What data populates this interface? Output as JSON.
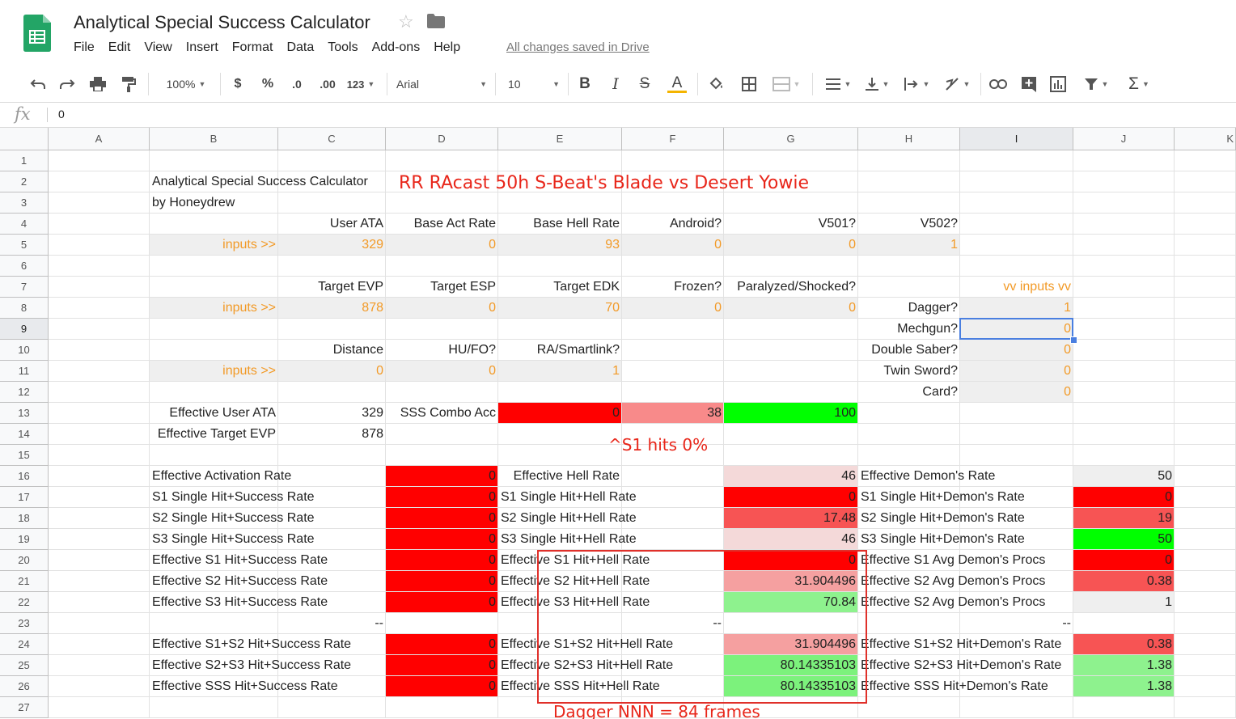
{
  "doc": {
    "title": "Analytical Special Success Calculator",
    "save_status": "All changes saved in Drive",
    "menu": [
      "File",
      "Edit",
      "View",
      "Insert",
      "Format",
      "Data",
      "Tools",
      "Add-ons",
      "Help"
    ]
  },
  "toolbar": {
    "zoom": "100%",
    "currency": "$",
    "percent": "%",
    "dec_decrease": ".0",
    "dec_increase": ".00",
    "more_formats": "123",
    "font": "Arial",
    "font_size": "10",
    "bold": "B",
    "italic": "I",
    "strike": "S",
    "text_color": "A"
  },
  "formula_bar": {
    "fx": "fx",
    "value": "0"
  },
  "columns": [
    "A",
    "B",
    "C",
    "D",
    "E",
    "F",
    "G",
    "H",
    "I",
    "J",
    "K"
  ],
  "rows": [
    "1",
    "2",
    "3",
    "4",
    "5",
    "6",
    "7",
    "8",
    "9",
    "10",
    "11",
    "12",
    "13",
    "14",
    "15",
    "16",
    "17",
    "18",
    "19",
    "20",
    "21",
    "22",
    "23",
    "24",
    "25",
    "26",
    "27"
  ],
  "sheet": {
    "title": "Analytical Special Success Calculator",
    "author": "by Honeydrew",
    "headline": "RR RAcast 50h S-Beat's Blade vs Desert Yowie",
    "note_s1": "^S1 hits 0%",
    "note_dagger": "Dagger NNN = 84 frames",
    "r4": {
      "c": "User ATA",
      "d": "Base Act Rate",
      "e": "Base Hell Rate",
      "f": "Android?",
      "g": "V501?",
      "h": "V502?"
    },
    "r5": {
      "b": "inputs >>",
      "c": "329",
      "d": "0",
      "e": "93",
      "f": "0",
      "g": "0",
      "h": "1"
    },
    "r7": {
      "c": "Target EVP",
      "d": "Target ESP",
      "e": "Target EDK",
      "f": "Frozen?",
      "g": "Paralyzed/Shocked?",
      "i": "vv inputs vv"
    },
    "r8": {
      "b": "inputs >>",
      "c": "878",
      "d": "0",
      "e": "70",
      "f": "0",
      "g": "0",
      "h": "Dagger?",
      "i": "1"
    },
    "r9": {
      "h": "Mechgun?",
      "i": "0"
    },
    "r10": {
      "c": "Distance",
      "d": "HU/FO?",
      "e": "RA/Smartlink?",
      "h": "Double Saber?",
      "i": "0"
    },
    "r11": {
      "b": "inputs >>",
      "c": "0",
      "d": "0",
      "e": "1",
      "h": "Twin Sword?",
      "i": "0"
    },
    "r12": {
      "h": "Card?",
      "i": "0"
    },
    "r13": {
      "b": "Effective User ATA",
      "c": "329",
      "d": "SSS Combo Acc",
      "e": "0",
      "f": "38",
      "g": "100"
    },
    "r14": {
      "b": "Effective Target EVP",
      "c": "878"
    },
    "r16": {
      "b": "Effective Activation Rate",
      "d": "0",
      "e": "Effective Hell Rate",
      "g": "46",
      "h": "Effective Demon's Rate",
      "j": "50"
    },
    "r17": {
      "b": "S1 Single Hit+Success Rate",
      "d": "0",
      "e": "S1 Single Hit+Hell Rate",
      "g": "0",
      "h": "S1 Single Hit+Demon's Rate",
      "j": "0"
    },
    "r18": {
      "b": "S2 Single Hit+Success Rate",
      "d": "0",
      "e": "S2 Single Hit+Hell Rate",
      "g": "17.48",
      "h": "S2 Single Hit+Demon's Rate",
      "j": "19"
    },
    "r19": {
      "b": "S3 Single Hit+Success Rate",
      "d": "0",
      "e": "S3 Single Hit+Hell Rate",
      "g": "46",
      "h": "S3 Single Hit+Demon's Rate",
      "j": "50"
    },
    "r20": {
      "b": "Effective S1 Hit+Success Rate",
      "d": "0",
      "e": "Effective S1 Hit+Hell Rate",
      "g": "0",
      "h": "Effective S1 Avg Demon's Procs",
      "j": "0"
    },
    "r21": {
      "b": "Effective S2 Hit+Success Rate",
      "d": "0",
      "e": "Effective S2 Hit+Hell Rate",
      "g": "31.904496",
      "h": "Effective S2 Avg Demon's Procs",
      "j": "0.38"
    },
    "r22": {
      "b": "Effective S3 Hit+Success Rate",
      "d": "0",
      "e": "Effective S3 Hit+Hell Rate",
      "g": "70.84",
      "h": "Effective S2 Avg Demon's Procs",
      "j": "1"
    },
    "r23": {
      "c": "--",
      "f": "--",
      "i": "--"
    },
    "r24": {
      "b": "Effective S1+S2 Hit+Success Rate",
      "d": "0",
      "e": "Effective S1+S2 Hit+Hell Rate",
      "g": "31.904496",
      "h": "Effective S1+S2 Hit+Demon's Rate",
      "j": "0.38"
    },
    "r25": {
      "b": "Effective S2+S3 Hit+Success Rate",
      "d": "0",
      "e": "Effective S2+S3 Hit+Hell Rate",
      "g": "80.14335103",
      "h": "Effective S2+S3 Hit+Demon's Rate",
      "j": "1.38"
    },
    "r26": {
      "b": "Effective SSS Hit+Success Rate",
      "d": "0",
      "e": "Effective SSS Hit+Hell Rate",
      "g": "80.14335103",
      "h": "Effective SSS Hit+Demon's Rate",
      "j": "1.38"
    }
  },
  "colors": {
    "red": "#ff0000",
    "green": "#00ff00",
    "input_orange": "#f29a27",
    "selection_blue": "#4a7fe0",
    "annotation_red": "#e8261a"
  }
}
